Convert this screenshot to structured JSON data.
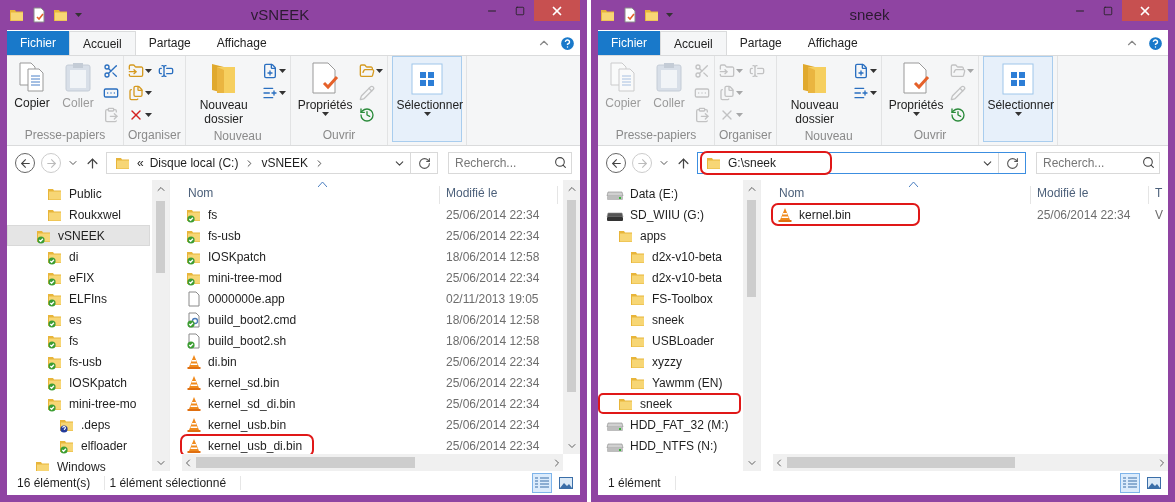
{
  "windows": [
    {
      "title": "vSNEEK",
      "tabs": [
        {
          "label": "Fichier",
          "kind": "menu",
          "selected": false
        },
        {
          "label": "Accueil",
          "kind": "tab",
          "selected": true
        },
        {
          "label": "Partage",
          "kind": "tab",
          "selected": false
        },
        {
          "label": "Affichage",
          "kind": "tab",
          "selected": false
        }
      ],
      "ribbon": [
        {
          "label": "Presse-papiers",
          "large": [
            {
              "label": "Copier",
              "kind": "copy",
              "disabled": false,
              "dropdown": false,
              "hovered": false
            },
            {
              "label": "Coller",
              "kind": "paste",
              "disabled": true,
              "dropdown": false,
              "hovered": false
            }
          ],
          "small": [
            {
              "kind": "scissors",
              "disabled": false,
              "dropdown": false
            },
            {
              "kind": "copy-path",
              "disabled": false,
              "dropdown": false
            },
            {
              "kind": "paste-shortcut",
              "disabled": true,
              "dropdown": false
            }
          ]
        },
        {
          "label": "Organiser",
          "small": [
            {
              "kind": "move-to",
              "disabled": false,
              "dropdown": true
            },
            {
              "kind": "copy-to",
              "disabled": false,
              "dropdown": true
            },
            {
              "kind": "delete",
              "disabled": false,
              "dropdown": true
            },
            {
              "kind": "rename",
              "disabled": false,
              "dropdown": false
            }
          ]
        },
        {
          "label": "Nouveau",
          "large": [
            {
              "label": "Nouveau dossier",
              "kind": "new-folder",
              "disabled": false,
              "dropdown": false,
              "hovered": false
            }
          ],
          "small": [
            {
              "kind": "new-item",
              "disabled": false,
              "dropdown": true
            },
            {
              "kind": "easy-access",
              "disabled": false,
              "dropdown": true
            }
          ]
        },
        {
          "label": "Ouvrir",
          "large": [
            {
              "label": "Propriétés",
              "kind": "properties",
              "disabled": false,
              "dropdown": true,
              "hovered": false
            }
          ],
          "small": [
            {
              "kind": "open",
              "disabled": false,
              "dropdown": true
            },
            {
              "kind": "edit",
              "disabled": true,
              "dropdown": false
            },
            {
              "kind": "history",
              "disabled": false,
              "dropdown": false
            }
          ]
        },
        {
          "large": [
            {
              "label": "Sélectionner",
              "kind": "select",
              "disabled": false,
              "dropdown": true,
              "hovered": true
            }
          ]
        }
      ],
      "address": {
        "kind": "breadcrumb",
        "overflow": "«",
        "segments": [
          "Disque local (C:)",
          "vSNEEK"
        ],
        "highlighted": false
      },
      "search": {
        "placeholder": "Recherch..."
      },
      "tree": [
        {
          "children": [
            {
              "label": "Public",
              "kind": "folder",
              "selected": false,
              "highlighted": false
            },
            {
              "label": "Roukxwel",
              "kind": "folder",
              "selected": false,
              "highlighted": false
            }
          ]
        },
        {
          "label": "vSNEEK",
          "kind": "synced-folder",
          "selected": true,
          "highlighted": false,
          "children": [
            {
              "label": "di",
              "kind": "synced-folder",
              "selected": false,
              "highlighted": false
            },
            {
              "label": "eFIX",
              "kind": "synced-folder",
              "selected": false,
              "highlighted": false
            },
            {
              "label": "ELFIns",
              "kind": "synced-folder",
              "selected": false,
              "highlighted": false
            },
            {
              "label": "es",
              "kind": "synced-folder",
              "selected": false,
              "highlighted": false
            },
            {
              "label": "fs",
              "kind": "synced-folder",
              "selected": false,
              "highlighted": false
            },
            {
              "label": "fs-usb",
              "kind": "synced-folder",
              "selected": false,
              "highlighted": false
            },
            {
              "label": "IOSKpatch",
              "kind": "synced-folder",
              "selected": false,
              "highlighted": false
            },
            {
              "label": "mini-tree-mo",
              "kind": "synced-folder",
              "selected": false,
              "highlighted": false,
              "children": [
                {
                  "label": ".deps",
                  "kind": "unknown-folder",
                  "selected": false,
                  "highlighted": false
                },
                {
                  "label": "elfloader",
                  "kind": "synced-folder",
                  "selected": false,
                  "highlighted": false
                }
              ]
            }
          ]
        },
        {
          "label": "Windows",
          "kind": "folder",
          "selected": false,
          "highlighted": false
        }
      ],
      "columns": [
        "Nom",
        "Modifié le"
      ],
      "files": [
        {
          "name": "fs",
          "date": "25/06/2014 22:34",
          "kind": "synced-folder",
          "highlighted": false
        },
        {
          "name": "fs-usb",
          "date": "25/06/2014 22:34",
          "kind": "synced-folder",
          "highlighted": false
        },
        {
          "name": "IOSKpatch",
          "date": "18/06/2014 12:58",
          "kind": "synced-folder",
          "highlighted": false
        },
        {
          "name": "mini-tree-mod",
          "date": "25/06/2014 22:34",
          "kind": "synced-folder",
          "highlighted": false
        },
        {
          "name": "0000000e.app",
          "date": "02/11/2013 19:05",
          "kind": "file",
          "highlighted": false
        },
        {
          "name": "build_boot2.cmd",
          "date": "18/06/2014 12:58",
          "kind": "synced-batch",
          "highlighted": false
        },
        {
          "name": "build_boot2.sh",
          "date": "18/06/2014 12:58",
          "kind": "synced-file",
          "highlighted": false
        },
        {
          "name": "di.bin",
          "date": "25/06/2014 22:34",
          "kind": "cone",
          "highlighted": false
        },
        {
          "name": "kernel_sd.bin",
          "date": "25/06/2014 22:34",
          "kind": "cone",
          "highlighted": false
        },
        {
          "name": "kernel_sd_di.bin",
          "date": "25/06/2014 22:34",
          "kind": "cone",
          "highlighted": false
        },
        {
          "name": "kernel_usb.bin",
          "date": "25/06/2014 22:34",
          "kind": "cone",
          "highlighted": false
        },
        {
          "name": "kernel_usb_di.bin",
          "date": "25/06/2014 22:34",
          "kind": "cone",
          "highlighted": true
        }
      ],
      "status": [
        "16 élément(s)",
        "1 élément sélectionné"
      ],
      "views": [
        {
          "kind": "details",
          "selected": true
        },
        {
          "kind": "large-icons",
          "selected": false
        }
      ]
    },
    {
      "title": "sneek",
      "tabs": [
        {
          "label": "Fichier",
          "kind": "menu",
          "selected": false
        },
        {
          "label": "Accueil",
          "kind": "tab",
          "selected": true
        },
        {
          "label": "Partage",
          "kind": "tab",
          "selected": false
        },
        {
          "label": "Affichage",
          "kind": "tab",
          "selected": false
        }
      ],
      "ribbon": [
        {
          "label": "Presse-papiers",
          "large": [
            {
              "label": "Copier",
              "kind": "copy",
              "disabled": true,
              "dropdown": false,
              "hovered": false
            },
            {
              "label": "Coller",
              "kind": "paste",
              "disabled": true,
              "dropdown": false,
              "hovered": false
            }
          ],
          "small": [
            {
              "kind": "scissors",
              "disabled": true,
              "dropdown": false
            },
            {
              "kind": "copy-path",
              "disabled": true,
              "dropdown": false
            },
            {
              "kind": "paste-shortcut",
              "disabled": true,
              "dropdown": false
            }
          ]
        },
        {
          "label": "Organiser",
          "small": [
            {
              "kind": "move-to",
              "disabled": true,
              "dropdown": true
            },
            {
              "kind": "copy-to",
              "disabled": true,
              "dropdown": true
            },
            {
              "kind": "delete",
              "disabled": true,
              "dropdown": true
            },
            {
              "kind": "rename",
              "disabled": true,
              "dropdown": false
            }
          ]
        },
        {
          "label": "Nouveau",
          "large": [
            {
              "label": "Nouveau dossier",
              "kind": "new-folder",
              "disabled": false,
              "dropdown": false,
              "hovered": false
            }
          ],
          "small": [
            {
              "kind": "new-item",
              "disabled": false,
              "dropdown": true
            },
            {
              "kind": "easy-access",
              "disabled": false,
              "dropdown": true
            }
          ]
        },
        {
          "label": "Ouvrir",
          "large": [
            {
              "label": "Propriétés",
              "kind": "properties",
              "disabled": false,
              "dropdown": true,
              "hovered": false
            }
          ],
          "small": [
            {
              "kind": "open",
              "disabled": true,
              "dropdown": true
            },
            {
              "kind": "edit",
              "disabled": true,
              "dropdown": false
            },
            {
              "kind": "history",
              "disabled": false,
              "dropdown": false
            }
          ]
        },
        {
          "large": [
            {
              "label": "Sélectionner",
              "kind": "select",
              "disabled": false,
              "dropdown": true,
              "hovered": true
            }
          ]
        }
      ],
      "address": {
        "kind": "edit",
        "value": "G:\\sneek",
        "highlighted": true
      },
      "search": {
        "placeholder": "Recherch..."
      },
      "tree": [
        {
          "label": "Data (E:)",
          "kind": "drive",
          "selected": false,
          "highlighted": false
        },
        {
          "label": "SD_WIIU (G:)",
          "kind": "card-drive",
          "selected": false,
          "highlighted": false,
          "children": [
            {
              "label": "apps",
              "kind": "folder",
              "selected": false,
              "highlighted": false,
              "children": [
                {
                  "label": "d2x-v10-beta",
                  "kind": "folder",
                  "selected": false,
                  "highlighted": false
                },
                {
                  "label": "d2x-v10-beta",
                  "kind": "folder",
                  "selected": false,
                  "highlighted": false
                },
                {
                  "label": "FS-Toolbox",
                  "kind": "folder",
                  "selected": false,
                  "highlighted": false
                },
                {
                  "label": "sneek",
                  "kind": "folder",
                  "selected": false,
                  "highlighted": false
                },
                {
                  "label": "USBLoader",
                  "kind": "folder",
                  "selected": false,
                  "highlighted": false
                },
                {
                  "label": "xyzzy",
                  "kind": "folder",
                  "selected": false,
                  "highlighted": false
                },
                {
                  "label": "Yawmm (EN)",
                  "kind": "folder",
                  "selected": false,
                  "highlighted": false
                }
              ]
            },
            {
              "label": "sneek",
              "kind": "folder",
              "selected": false,
              "highlighted": true
            }
          ]
        },
        {
          "label": "HDD_FAT_32 (M:)",
          "kind": "drive",
          "selected": false,
          "highlighted": false
        },
        {
          "label": "HDD_NTFS (N:)",
          "kind": "drive",
          "selected": false,
          "highlighted": false
        }
      ],
      "columns": [
        "Nom",
        "Modifié le",
        "T"
      ],
      "files": [
        {
          "name": "kernel.bin",
          "date": "25/06/2014 22:34",
          "type": "V",
          "kind": "cone",
          "highlighted": true
        }
      ],
      "status": [
        "1 élément"
      ],
      "views": [
        {
          "kind": "details",
          "selected": true
        },
        {
          "kind": "large-icons",
          "selected": false
        }
      ]
    }
  ]
}
